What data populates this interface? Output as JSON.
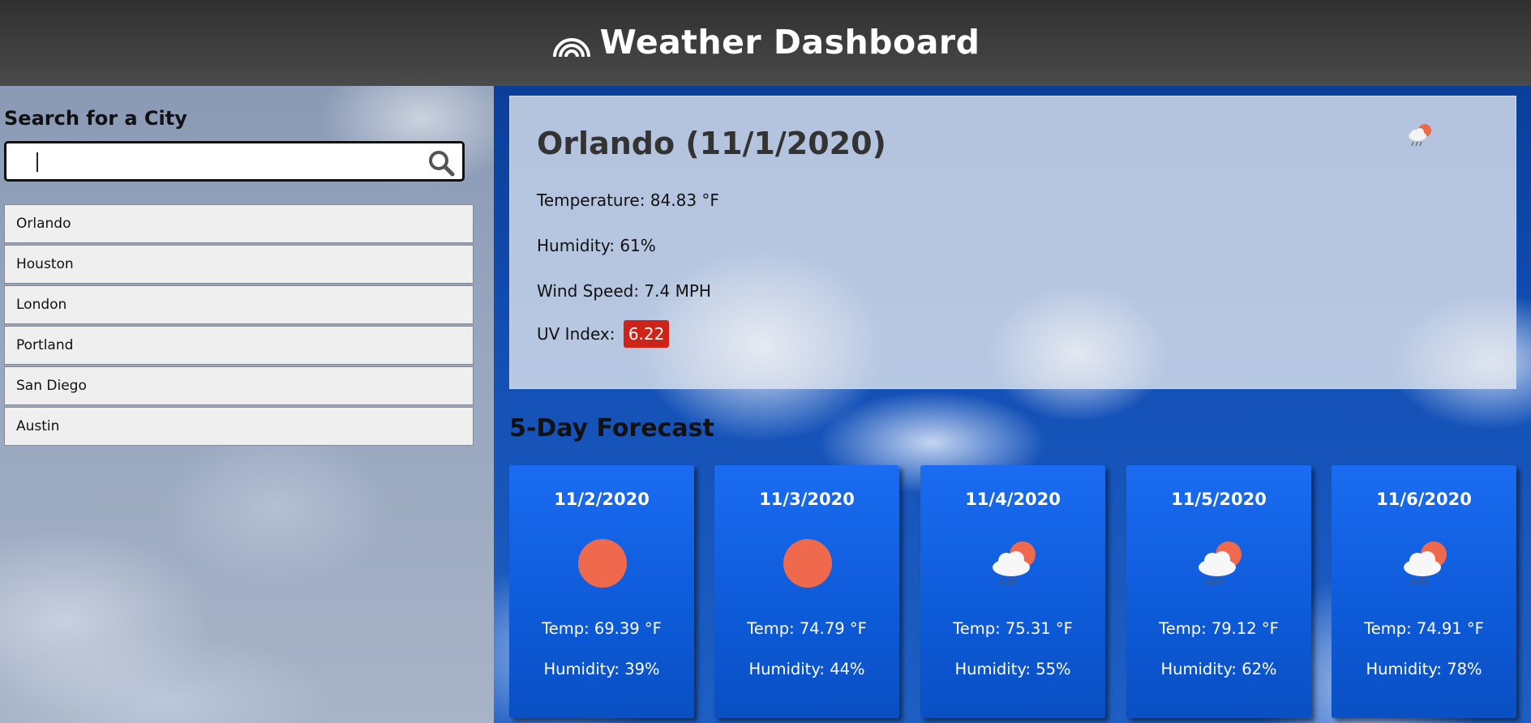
{
  "header": {
    "title": "Weather Dashboard",
    "logo_icon": "rainbow-icon"
  },
  "sidebar": {
    "heading": "Search for a City",
    "search": {
      "value": "",
      "placeholder": "",
      "icon": "search-icon"
    },
    "cities": [
      "Orlando",
      "Houston",
      "London",
      "Portland",
      "San Diego",
      "Austin"
    ]
  },
  "current": {
    "title": "Orlando (11/1/2020)",
    "icon": "rain-cloud-sun-icon",
    "temperature": "Temperature: 84.83 °F",
    "humidity": "Humidity: 61%",
    "wind": "Wind Speed: 7.4 MPH",
    "uv_label": "UV Index:",
    "uv_value": "6.22",
    "uv_color": "#cc2418"
  },
  "forecast": {
    "title": "5-Day Forecast",
    "days": [
      {
        "date": "11/2/2020",
        "icon": "sun-icon",
        "temp": "Temp: 69.39 °F",
        "humidity": "Humidity: 39%"
      },
      {
        "date": "11/3/2020",
        "icon": "sun-icon",
        "temp": "Temp: 74.79 °F",
        "humidity": "Humidity: 44%"
      },
      {
        "date": "11/4/2020",
        "icon": "rain-cloud-sun-icon",
        "temp": "Temp: 75.31 °F",
        "humidity": "Humidity: 55%"
      },
      {
        "date": "11/5/2020",
        "icon": "rain-cloud-sun-icon",
        "temp": "Temp: 79.12 °F",
        "humidity": "Humidity: 62%"
      },
      {
        "date": "11/6/2020",
        "icon": "rain-cloud-sun-icon",
        "temp": "Temp: 74.91 °F",
        "humidity": "Humidity: 78%"
      }
    ]
  }
}
